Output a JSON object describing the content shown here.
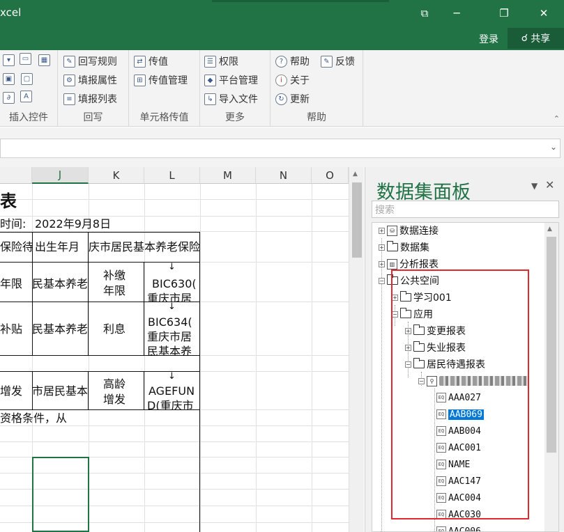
{
  "titlebar": {
    "title": "xcel",
    "controls": {
      "restore_icon": "⧉",
      "minimize": "─",
      "maximize": "❐",
      "close": "✕"
    }
  },
  "account": {
    "login_label": "登录",
    "share_label": "共享"
  },
  "ribbon": {
    "groups": [
      {
        "label": "插入控件"
      },
      {
        "label": "回写",
        "buttons": [
          "回写规则",
          "填报属性",
          "填报列表"
        ]
      },
      {
        "label": "单元格传值",
        "buttons": [
          "传值",
          "传值管理"
        ]
      },
      {
        "label": "更多",
        "buttons": [
          "权限",
          "平台管理",
          "导入文件"
        ]
      },
      {
        "label": "帮助",
        "buttons": [
          "帮助",
          "关于",
          "更新",
          "反馈"
        ]
      }
    ]
  },
  "sheet": {
    "columns": [
      "J",
      "K",
      "L",
      "M",
      "N",
      "O"
    ],
    "selected_column": "J",
    "cells": {
      "title": "表",
      "date_label": "时间:",
      "date_value": "2022年9月8日",
      "hdr_a": "保险待",
      "hdr_b": "出生年月",
      "hdr_c": "庆市居民基本养老保险",
      "r1_a": "年限",
      "r1_b": "民基本养老",
      "r1_c1": "补缴",
      "r1_c2": "年限",
      "r1_d1": "BIC630(",
      "r1_d2": "重庆市居",
      "r2_a": "补贴",
      "r2_b": "民基本养老",
      "r2_c": "利息",
      "r2_d1": "BIC634(",
      "r2_d2": "重庆市居",
      "r2_d3": "民基本养",
      "r3_a": "增发",
      "r3_b": "市居民基本",
      "r3_c1": "高龄",
      "r3_c2": "增发",
      "r3_d1": "AGEFUN",
      "r3_d2": "D(重庆市",
      "note": "资格条件，从",
      "arrow": "↓"
    }
  },
  "panel": {
    "title": "数据集面板",
    "search_placeholder": "搜索",
    "tree": {
      "root_items": [
        "数据连接",
        "数据集",
        "分析报表",
        "公共空间"
      ],
      "public_children": [
        "学习001",
        "应用"
      ],
      "app_children": [
        "变更报表",
        "失业报表",
        "居民待遇报表"
      ],
      "fields": [
        "AAA027",
        "AAB069",
        "AAB004",
        "AAC001",
        "NAME",
        "AAC147",
        "AAC004",
        "AAC030",
        "AAC006"
      ],
      "selected_field": "AAB069"
    }
  },
  "colors": {
    "brand": "#217346",
    "highlight": "#0078d7",
    "annotation": "#e0282e"
  }
}
